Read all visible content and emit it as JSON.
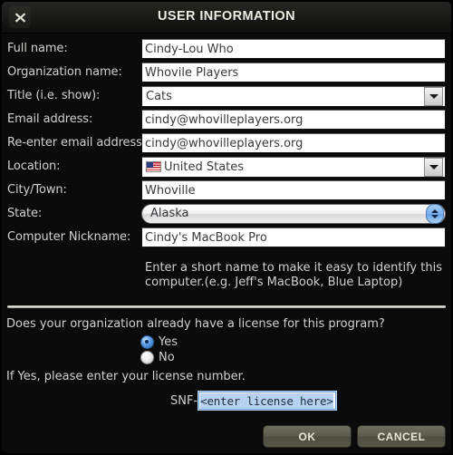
{
  "window": {
    "title": "USER INFORMATION",
    "close_icon": "close-icon"
  },
  "form": {
    "fields": [
      {
        "label": "Full name:",
        "value": "Cindy-Lou Who",
        "type": "text"
      },
      {
        "label": "Organization name:",
        "value": "Whovile Players",
        "type": "text"
      },
      {
        "label": "Title (i.e. show):",
        "value": "Cats",
        "type": "combo"
      },
      {
        "label": "Email address:",
        "value": "cindy@whovilleplayers.org",
        "type": "text"
      },
      {
        "label": "Re-enter email address:",
        "value": "cindy@whovilleplayers.org",
        "type": "text"
      },
      {
        "label": "Location:",
        "value": "United States",
        "type": "combo-flag"
      },
      {
        "label": "City/Town:",
        "value": "Whoville",
        "type": "text"
      },
      {
        "label": "State:",
        "value": "Alaska",
        "type": "stepper"
      },
      {
        "label": "Computer Nickname:",
        "value": "Cindy's MacBook Pro",
        "type": "text"
      }
    ],
    "hint_line1": "Enter a short name to make it easy to identify this",
    "hint_line2": "computer.(e.g. Jeff's MacBook, Blue Laptop)"
  },
  "license": {
    "question": "Does your organization already have a license for this program?",
    "option_yes": "Yes",
    "option_no": "No",
    "selected": "Yes",
    "note": "If Yes, please enter your license number.",
    "snf_prefix": "SNF-",
    "snf_value": "<enter license here>"
  },
  "footer": {
    "ok_label": "OK",
    "cancel_label": "CANCEL"
  },
  "colors": {
    "window_bg": "#0a0a0a",
    "label_text": "#d2d2cc",
    "input_bg": "#ffffff",
    "accent_blue": "#6aa6e8",
    "button_bg": "#5c5c4e",
    "selection_blue": "#b6d2ef"
  }
}
